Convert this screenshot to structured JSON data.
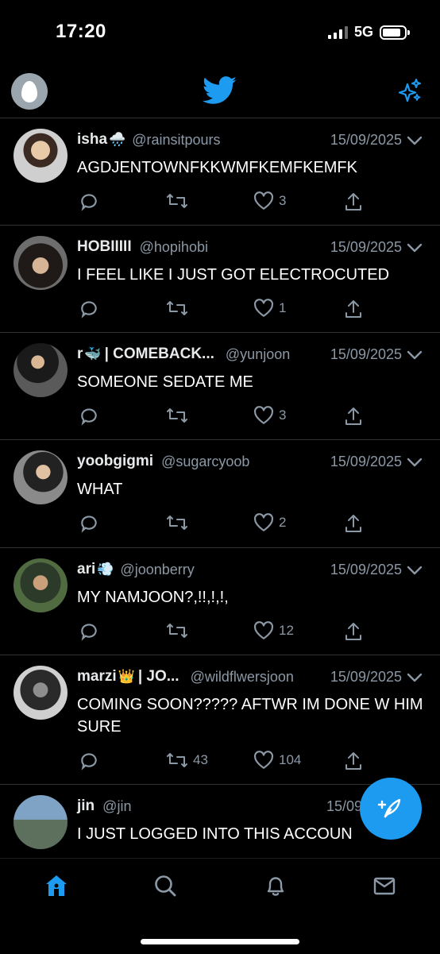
{
  "status_bar": {
    "time": "17:20",
    "network": "5G"
  },
  "top_nav": {
    "avatar_icon": "egg-avatar-icon",
    "logo_icon": "twitter-bird-icon",
    "sparkle_icon": "sparkle-icon"
  },
  "colors": {
    "accent": "#1d9bf0",
    "background": "#000000",
    "text_primary": "#e7e9ea",
    "text_secondary": "#8b98a5",
    "divider": "#2f3336"
  },
  "tweets": [
    {
      "name": "isha",
      "emoji": "🌧️",
      "handle": "@rainsitpours",
      "date": "15/09/2025",
      "text": "AGDJENTOWNFKKWMFKEMFKEMFK",
      "retweets": "",
      "likes": "3"
    },
    {
      "name": "HOBIIIII",
      "emoji": "",
      "handle": "@hopihobi",
      "date": "15/09/2025",
      "text": "I FEEL LIKE I JUST GOT ELECTROCUTED",
      "retweets": "",
      "likes": "1"
    },
    {
      "name": "r",
      "emoji": "🐳",
      "name_suffix": "| COMEBACK...",
      "handle": "@yunjoon",
      "date": "15/09/2025",
      "text": "SOMEONE SEDATE ME",
      "retweets": "",
      "likes": "3"
    },
    {
      "name": "yoobgigmi",
      "emoji": "",
      "handle": "@sugarcyoob",
      "date": "15/09/2025",
      "text": "WHAT",
      "retweets": "",
      "likes": "2"
    },
    {
      "name": "ari",
      "emoji": "💨",
      "handle": "@joonberry",
      "date": "15/09/2025",
      "text": "MY NAMJOON?,!!,!,!,",
      "retweets": "",
      "likes": "12"
    },
    {
      "name": "marzi",
      "emoji": "👑",
      "name_suffix": "| JO...",
      "handle": "@wildflwersjoon",
      "date": "15/09/2025",
      "text": "COMING SOON????? AFTWR IM DONE W HIM SURE",
      "retweets": "43",
      "likes": "104"
    },
    {
      "name": "jin",
      "emoji": "",
      "handle": "@jin",
      "date": "15/09",
      "text": "I JUST LOGGED INTO THIS ACCOUN",
      "retweets": "",
      "likes": ""
    }
  ],
  "bottom_nav": [
    "home-icon",
    "search-icon",
    "notifications-bell-icon",
    "messages-envelope-icon"
  ]
}
